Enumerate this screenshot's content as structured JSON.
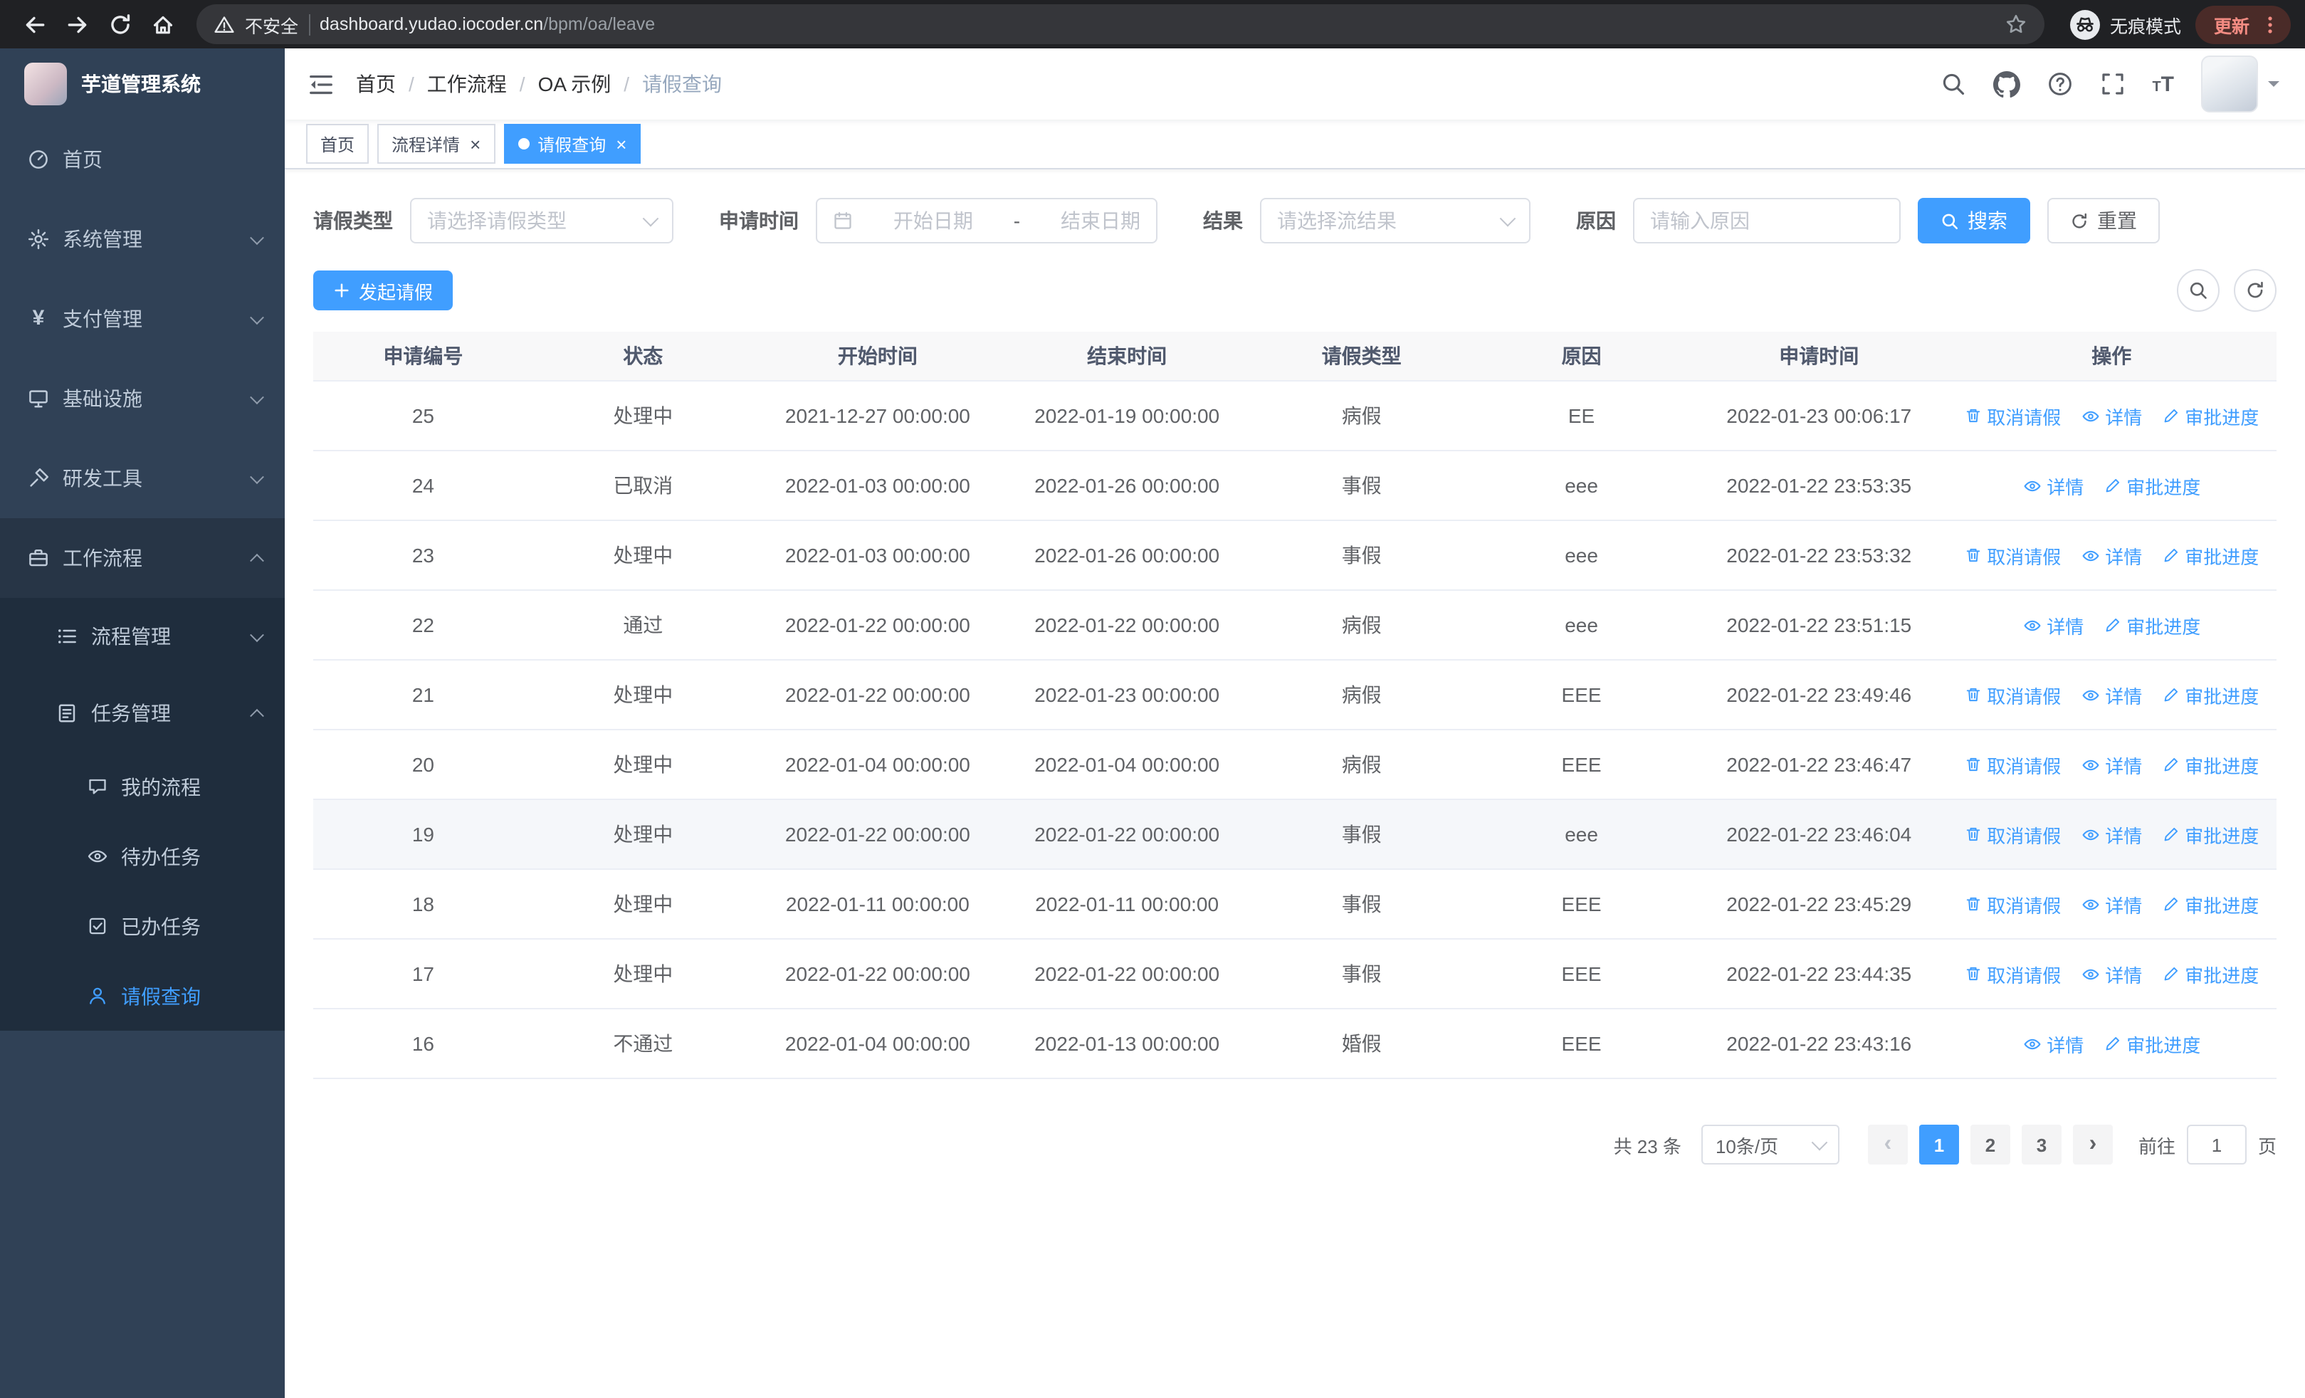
{
  "colors": {
    "primary": "#409eff",
    "chrome_bg": "#202124",
    "omnibox_bg": "#35363a",
    "update_badge_bg": "#4a2b28",
    "update_badge_text": "#f28b82",
    "sidebar_bg": "#304156",
    "sidebar_submenu_bg": "#1f2d3d",
    "sidebar_text": "#bfcbd9",
    "table_header_bg": "#f8f8f9",
    "row_highlight": "#f5f7fa"
  },
  "icons": {
    "browser": [
      "back-arrow",
      "forward-arrow",
      "reload",
      "home",
      "warning-triangle",
      "star",
      "incognito",
      "kebab-menu"
    ],
    "navbar": [
      "fold-menu",
      "search",
      "github",
      "question-circle",
      "fullscreen",
      "font-size",
      "caret-down"
    ],
    "sidebar": [
      "dashboard",
      "gear",
      "yen",
      "monitor",
      "hammer",
      "briefcase",
      "list",
      "clipboard",
      "chat-bubble",
      "eye",
      "checkbox",
      "user"
    ],
    "table_actions": [
      "trash",
      "eye",
      "edit"
    ],
    "form": [
      "calendar",
      "chevron-down",
      "magnifier",
      "refresh",
      "plus"
    ]
  },
  "browser": {
    "security_label": "不安全",
    "url_domain": "dashboard.yudao.iocoder.cn",
    "url_path": "/bpm/oa/leave",
    "incognito_label": "无痕模式",
    "update_label": "更新"
  },
  "sidebar": {
    "app_title": "芋道管理系统",
    "items": [
      {
        "label": "首页",
        "icon": "dashboard-icon",
        "level": 1
      },
      {
        "label": "系统管理",
        "icon": "gear-icon",
        "level": 1,
        "expand": "down"
      },
      {
        "label": "支付管理",
        "icon": "yen-icon",
        "level": 1,
        "expand": "down"
      },
      {
        "label": "基础设施",
        "icon": "monitor-icon",
        "level": 1,
        "expand": "down"
      },
      {
        "label": "研发工具",
        "icon": "hammer-icon",
        "level": 1,
        "expand": "down"
      },
      {
        "label": "工作流程",
        "icon": "briefcase-icon",
        "level": 1,
        "expand": "up",
        "open": true
      },
      {
        "label": "流程管理",
        "icon": "list-icon",
        "level": 2,
        "expand": "down"
      },
      {
        "label": "任务管理",
        "icon": "clipboard-icon",
        "level": 2,
        "expand": "up",
        "open": true
      },
      {
        "label": "我的流程",
        "icon": "chat-icon",
        "level": 3
      },
      {
        "label": "待办任务",
        "icon": "eye-icon",
        "level": 3
      },
      {
        "label": "已办任务",
        "icon": "checkbox-icon",
        "level": 3
      },
      {
        "label": "请假查询",
        "icon": "user-icon",
        "level": 3,
        "active": true
      }
    ]
  },
  "header": {
    "breadcrumb": [
      "首页",
      "工作流程",
      "OA 示例",
      "请假查询"
    ]
  },
  "tabs": [
    {
      "label": "首页",
      "closable": false,
      "active": false
    },
    {
      "label": "流程详情",
      "closable": true,
      "active": false
    },
    {
      "label": "请假查询",
      "closable": true,
      "active": true
    }
  ],
  "filters": {
    "leave_type_label": "请假类型",
    "leave_type_placeholder": "请选择请假类型",
    "apply_time_label": "申请时间",
    "start_date_placeholder": "开始日期",
    "range_separator": "-",
    "end_date_placeholder": "结束日期",
    "result_label": "结果",
    "result_placeholder": "请选择流结果",
    "reason_label": "原因",
    "reason_placeholder": "请输入原因",
    "search_label": "搜索",
    "reset_label": "重置"
  },
  "toolbar": {
    "create_label": "发起请假"
  },
  "table": {
    "columns": [
      "申请编号",
      "状态",
      "开始时间",
      "结束时间",
      "请假类型",
      "原因",
      "申请时间",
      "操作"
    ],
    "action_labels": {
      "cancel": "取消请假",
      "detail": "详情",
      "progress": "审批进度"
    },
    "rows": [
      {
        "id": "25",
        "status": "处理中",
        "start": "2021-12-27 00:00:00",
        "end": "2022-01-19 00:00:00",
        "type": "病假",
        "reason": "EE",
        "applied": "2022-01-23 00:06:17",
        "actions": [
          "cancel",
          "detail",
          "progress"
        ],
        "highlight": false
      },
      {
        "id": "24",
        "status": "已取消",
        "start": "2022-01-03 00:00:00",
        "end": "2022-01-26 00:00:00",
        "type": "事假",
        "reason": "eee",
        "applied": "2022-01-22 23:53:35",
        "actions": [
          "detail",
          "progress"
        ],
        "highlight": false
      },
      {
        "id": "23",
        "status": "处理中",
        "start": "2022-01-03 00:00:00",
        "end": "2022-01-26 00:00:00",
        "type": "事假",
        "reason": "eee",
        "applied": "2022-01-22 23:53:32",
        "actions": [
          "cancel",
          "detail",
          "progress"
        ],
        "highlight": false
      },
      {
        "id": "22",
        "status": "通过",
        "start": "2022-01-22 00:00:00",
        "end": "2022-01-22 00:00:00",
        "type": "病假",
        "reason": "eee",
        "applied": "2022-01-22 23:51:15",
        "actions": [
          "detail",
          "progress"
        ],
        "highlight": false
      },
      {
        "id": "21",
        "status": "处理中",
        "start": "2022-01-22 00:00:00",
        "end": "2022-01-23 00:00:00",
        "type": "病假",
        "reason": "EEE",
        "applied": "2022-01-22 23:49:46",
        "actions": [
          "cancel",
          "detail",
          "progress"
        ],
        "highlight": false
      },
      {
        "id": "20",
        "status": "处理中",
        "start": "2022-01-04 00:00:00",
        "end": "2022-01-04 00:00:00",
        "type": "病假",
        "reason": "EEE",
        "applied": "2022-01-22 23:46:47",
        "actions": [
          "cancel",
          "detail",
          "progress"
        ],
        "highlight": false
      },
      {
        "id": "19",
        "status": "处理中",
        "start": "2022-01-22 00:00:00",
        "end": "2022-01-22 00:00:00",
        "type": "事假",
        "reason": "eee",
        "applied": "2022-01-22 23:46:04",
        "actions": [
          "cancel",
          "detail",
          "progress"
        ],
        "highlight": true
      },
      {
        "id": "18",
        "status": "处理中",
        "start": "2022-01-11 00:00:00",
        "end": "2022-01-11 00:00:00",
        "type": "事假",
        "reason": "EEE",
        "applied": "2022-01-22 23:45:29",
        "actions": [
          "cancel",
          "detail",
          "progress"
        ],
        "highlight": false
      },
      {
        "id": "17",
        "status": "处理中",
        "start": "2022-01-22 00:00:00",
        "end": "2022-01-22 00:00:00",
        "type": "事假",
        "reason": "EEE",
        "applied": "2022-01-22 23:44:35",
        "actions": [
          "cancel",
          "detail",
          "progress"
        ],
        "highlight": false
      },
      {
        "id": "16",
        "status": "不通过",
        "start": "2022-01-04 00:00:00",
        "end": "2022-01-13 00:00:00",
        "type": "婚假",
        "reason": "EEE",
        "applied": "2022-01-22 23:43:16",
        "actions": [
          "detail",
          "progress"
        ],
        "highlight": false
      }
    ]
  },
  "pagination": {
    "total_label": "共 23 条",
    "page_size": "10条/页",
    "pages": [
      "1",
      "2",
      "3"
    ],
    "active_page": "1",
    "prev_label": "‹",
    "next_label": "›",
    "goto_label": "前往",
    "goto_value": "1",
    "page_suffix": "页"
  }
}
